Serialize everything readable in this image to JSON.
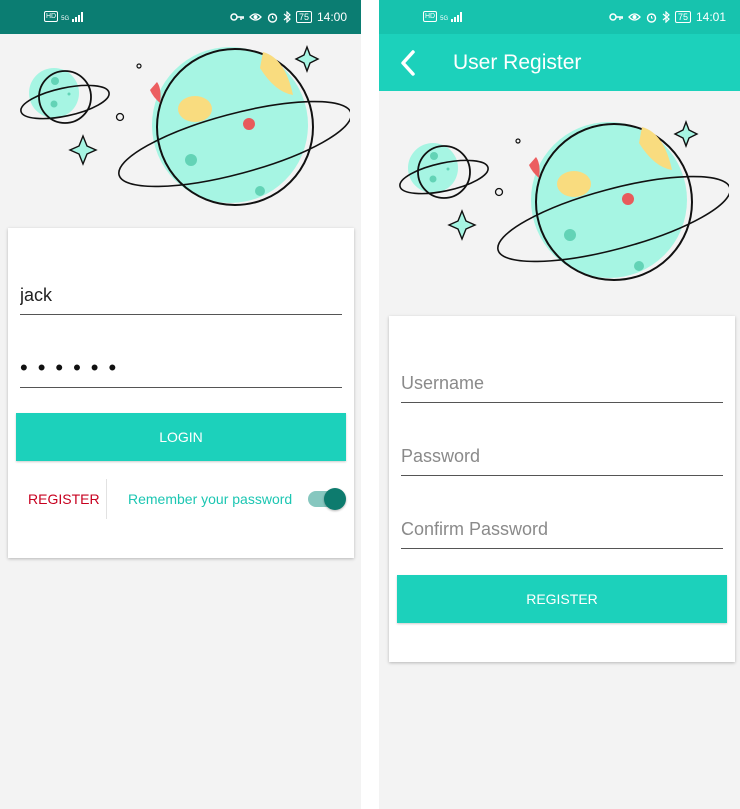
{
  "status_left": {
    "network_badge": "HD",
    "network_type": "5G"
  },
  "screen1": {
    "status": {
      "time": "14:00",
      "battery": "75"
    },
    "login": {
      "username": "jack",
      "password_mask": "••••••",
      "login_button": "LOGIN",
      "register_link": "REGISTER",
      "remember_label": "Remember your password",
      "remember_on": true
    }
  },
  "screen2": {
    "status": {
      "time": "14:01",
      "battery": "75"
    },
    "appbar": {
      "title": "User Register",
      "back_icon": "chevron-left-icon"
    },
    "form": {
      "username_placeholder": "Username",
      "password_placeholder": "Password",
      "confirm_placeholder": "Confirm Password",
      "register_button": "REGISTER"
    }
  },
  "colors": {
    "status_bar": "#0b7d72",
    "accent": "#1cd1bb",
    "register_link": "#c7001f",
    "switch_knob": "#0d7b6e"
  }
}
